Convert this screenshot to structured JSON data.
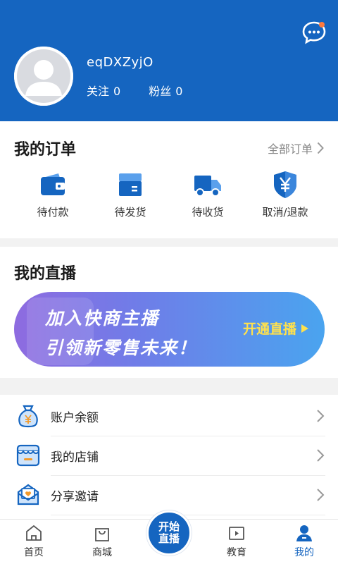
{
  "header": {
    "username": "eqDXZyjO",
    "follow_label": "关注",
    "follow_count": "0",
    "fans_label": "粉丝",
    "fans_count": "0",
    "message_icon": "chat-bubble-icon",
    "bg_color": "#1565c0"
  },
  "orders": {
    "title": "我的订单",
    "all_label": "全部订单",
    "items": [
      {
        "label": "待付款",
        "icon": "wallet-icon"
      },
      {
        "label": "待发货",
        "icon": "box-icon"
      },
      {
        "label": "待收货",
        "icon": "truck-icon"
      },
      {
        "label": "取消/退款",
        "icon": "yen-shield-icon"
      }
    ]
  },
  "live": {
    "title": "我的直播",
    "banner_line1": "加入快商主播",
    "banner_line2": "引领新零售未来！",
    "banner_cta": "开通直播"
  },
  "menu": [
    {
      "label": "账户余额",
      "icon": "money-bag-icon"
    },
    {
      "label": "我的店铺",
      "icon": "store-icon"
    },
    {
      "label": "分享邀请",
      "icon": "invite-envelope-icon"
    }
  ],
  "tabbar": {
    "tabs": [
      {
        "label": "首页",
        "icon": "home-icon"
      },
      {
        "label": "商城",
        "icon": "shopping-bag-icon"
      },
      {
        "label": "教育",
        "icon": "video-book-icon"
      },
      {
        "label": "我的",
        "icon": "user-icon"
      }
    ],
    "center_line1": "开始",
    "center_line2": "直播",
    "active_color": "#1565c0"
  }
}
